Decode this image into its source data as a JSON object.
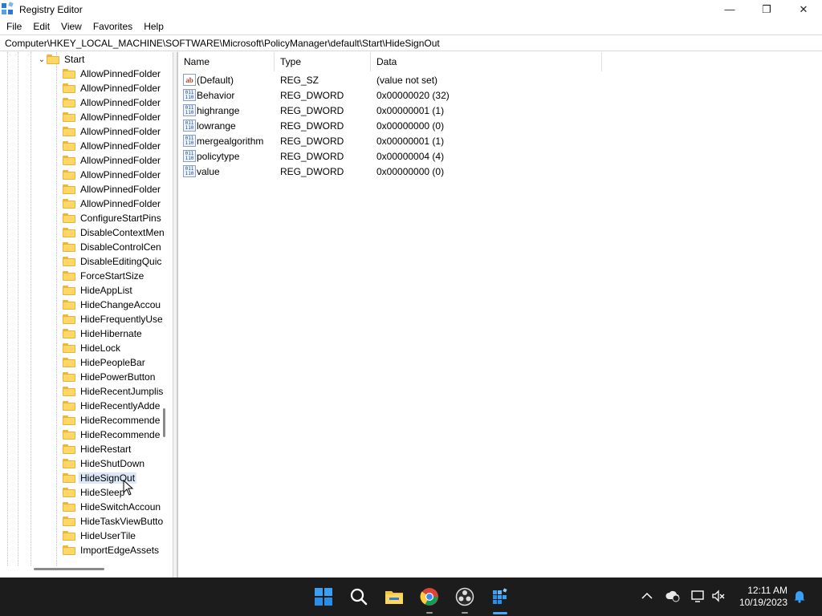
{
  "window": {
    "title": "Registry Editor",
    "controls": {
      "minimize": "—",
      "maximize": "❐",
      "close": "✕"
    }
  },
  "menu": [
    "File",
    "Edit",
    "View",
    "Favorites",
    "Help"
  ],
  "address": "Computer\\HKEY_LOCAL_MACHINE\\SOFTWARE\\Microsoft\\PolicyManager\\default\\Start\\HideSignOut",
  "tree": {
    "parent": {
      "label": "Start",
      "expanded": true
    },
    "children": [
      "AllowPinnedFolder",
      "AllowPinnedFolder",
      "AllowPinnedFolder",
      "AllowPinnedFolder",
      "AllowPinnedFolder",
      "AllowPinnedFolder",
      "AllowPinnedFolder",
      "AllowPinnedFolder",
      "AllowPinnedFolder",
      "AllowPinnedFolder",
      "ConfigureStartPins",
      "DisableContextMen",
      "DisableControlCen",
      "DisableEditingQuic",
      "ForceStartSize",
      "HideAppList",
      "HideChangeAccou",
      "HideFrequentlyUse",
      "HideHibernate",
      "HideLock",
      "HidePeopleBar",
      "HidePowerButton",
      "HideRecentJumplis",
      "HideRecentlyAdde",
      "HideRecommende",
      "HideRecommende",
      "HideRestart",
      "HideShutDown",
      "HideSignOut",
      "HideSleep",
      "HideSwitchAccoun",
      "HideTaskViewButto",
      "HideUserTile",
      "ImportEdgeAssets"
    ],
    "selected": "HideSignOut"
  },
  "columns": {
    "name": "Name",
    "type": "Type",
    "data": "Data"
  },
  "values": [
    {
      "icon": "string-value-icon",
      "glyph": "ab",
      "name": "(Default)",
      "type": "REG_SZ",
      "data": "(value not set)"
    },
    {
      "icon": "dword-value-icon",
      "glyph": "011\n110",
      "name": "Behavior",
      "type": "REG_DWORD",
      "data": "0x00000020 (32)"
    },
    {
      "icon": "dword-value-icon",
      "glyph": "011\n110",
      "name": "highrange",
      "type": "REG_DWORD",
      "data": "0x00000001 (1)"
    },
    {
      "icon": "dword-value-icon",
      "glyph": "011\n110",
      "name": "lowrange",
      "type": "REG_DWORD",
      "data": "0x00000000 (0)"
    },
    {
      "icon": "dword-value-icon",
      "glyph": "011\n110",
      "name": "mergealgorithm",
      "type": "REG_DWORD",
      "data": "0x00000001 (1)"
    },
    {
      "icon": "dword-value-icon",
      "glyph": "011\n110",
      "name": "policytype",
      "type": "REG_DWORD",
      "data": "0x00000004 (4)"
    },
    {
      "icon": "dword-value-icon",
      "glyph": "011\n110",
      "name": "value",
      "type": "REG_DWORD",
      "data": "0x00000000 (0)"
    }
  ],
  "taskbar": {
    "apps": [
      "start-icon",
      "search-icon",
      "file-explorer-icon",
      "chrome-icon",
      "obs-icon",
      "registry-editor-icon"
    ],
    "tray": [
      "chevron-up-icon",
      "cloud-sync-icon",
      "network-icon",
      "volume-muted-icon",
      "notification-bell-icon"
    ],
    "time": "12:11 AM",
    "date": "10/19/2023"
  },
  "colors": {
    "accent": "#2b7bd6",
    "selection": "#dce8f7",
    "taskbar": "#1c1c1c",
    "folder": "#ffd766"
  }
}
